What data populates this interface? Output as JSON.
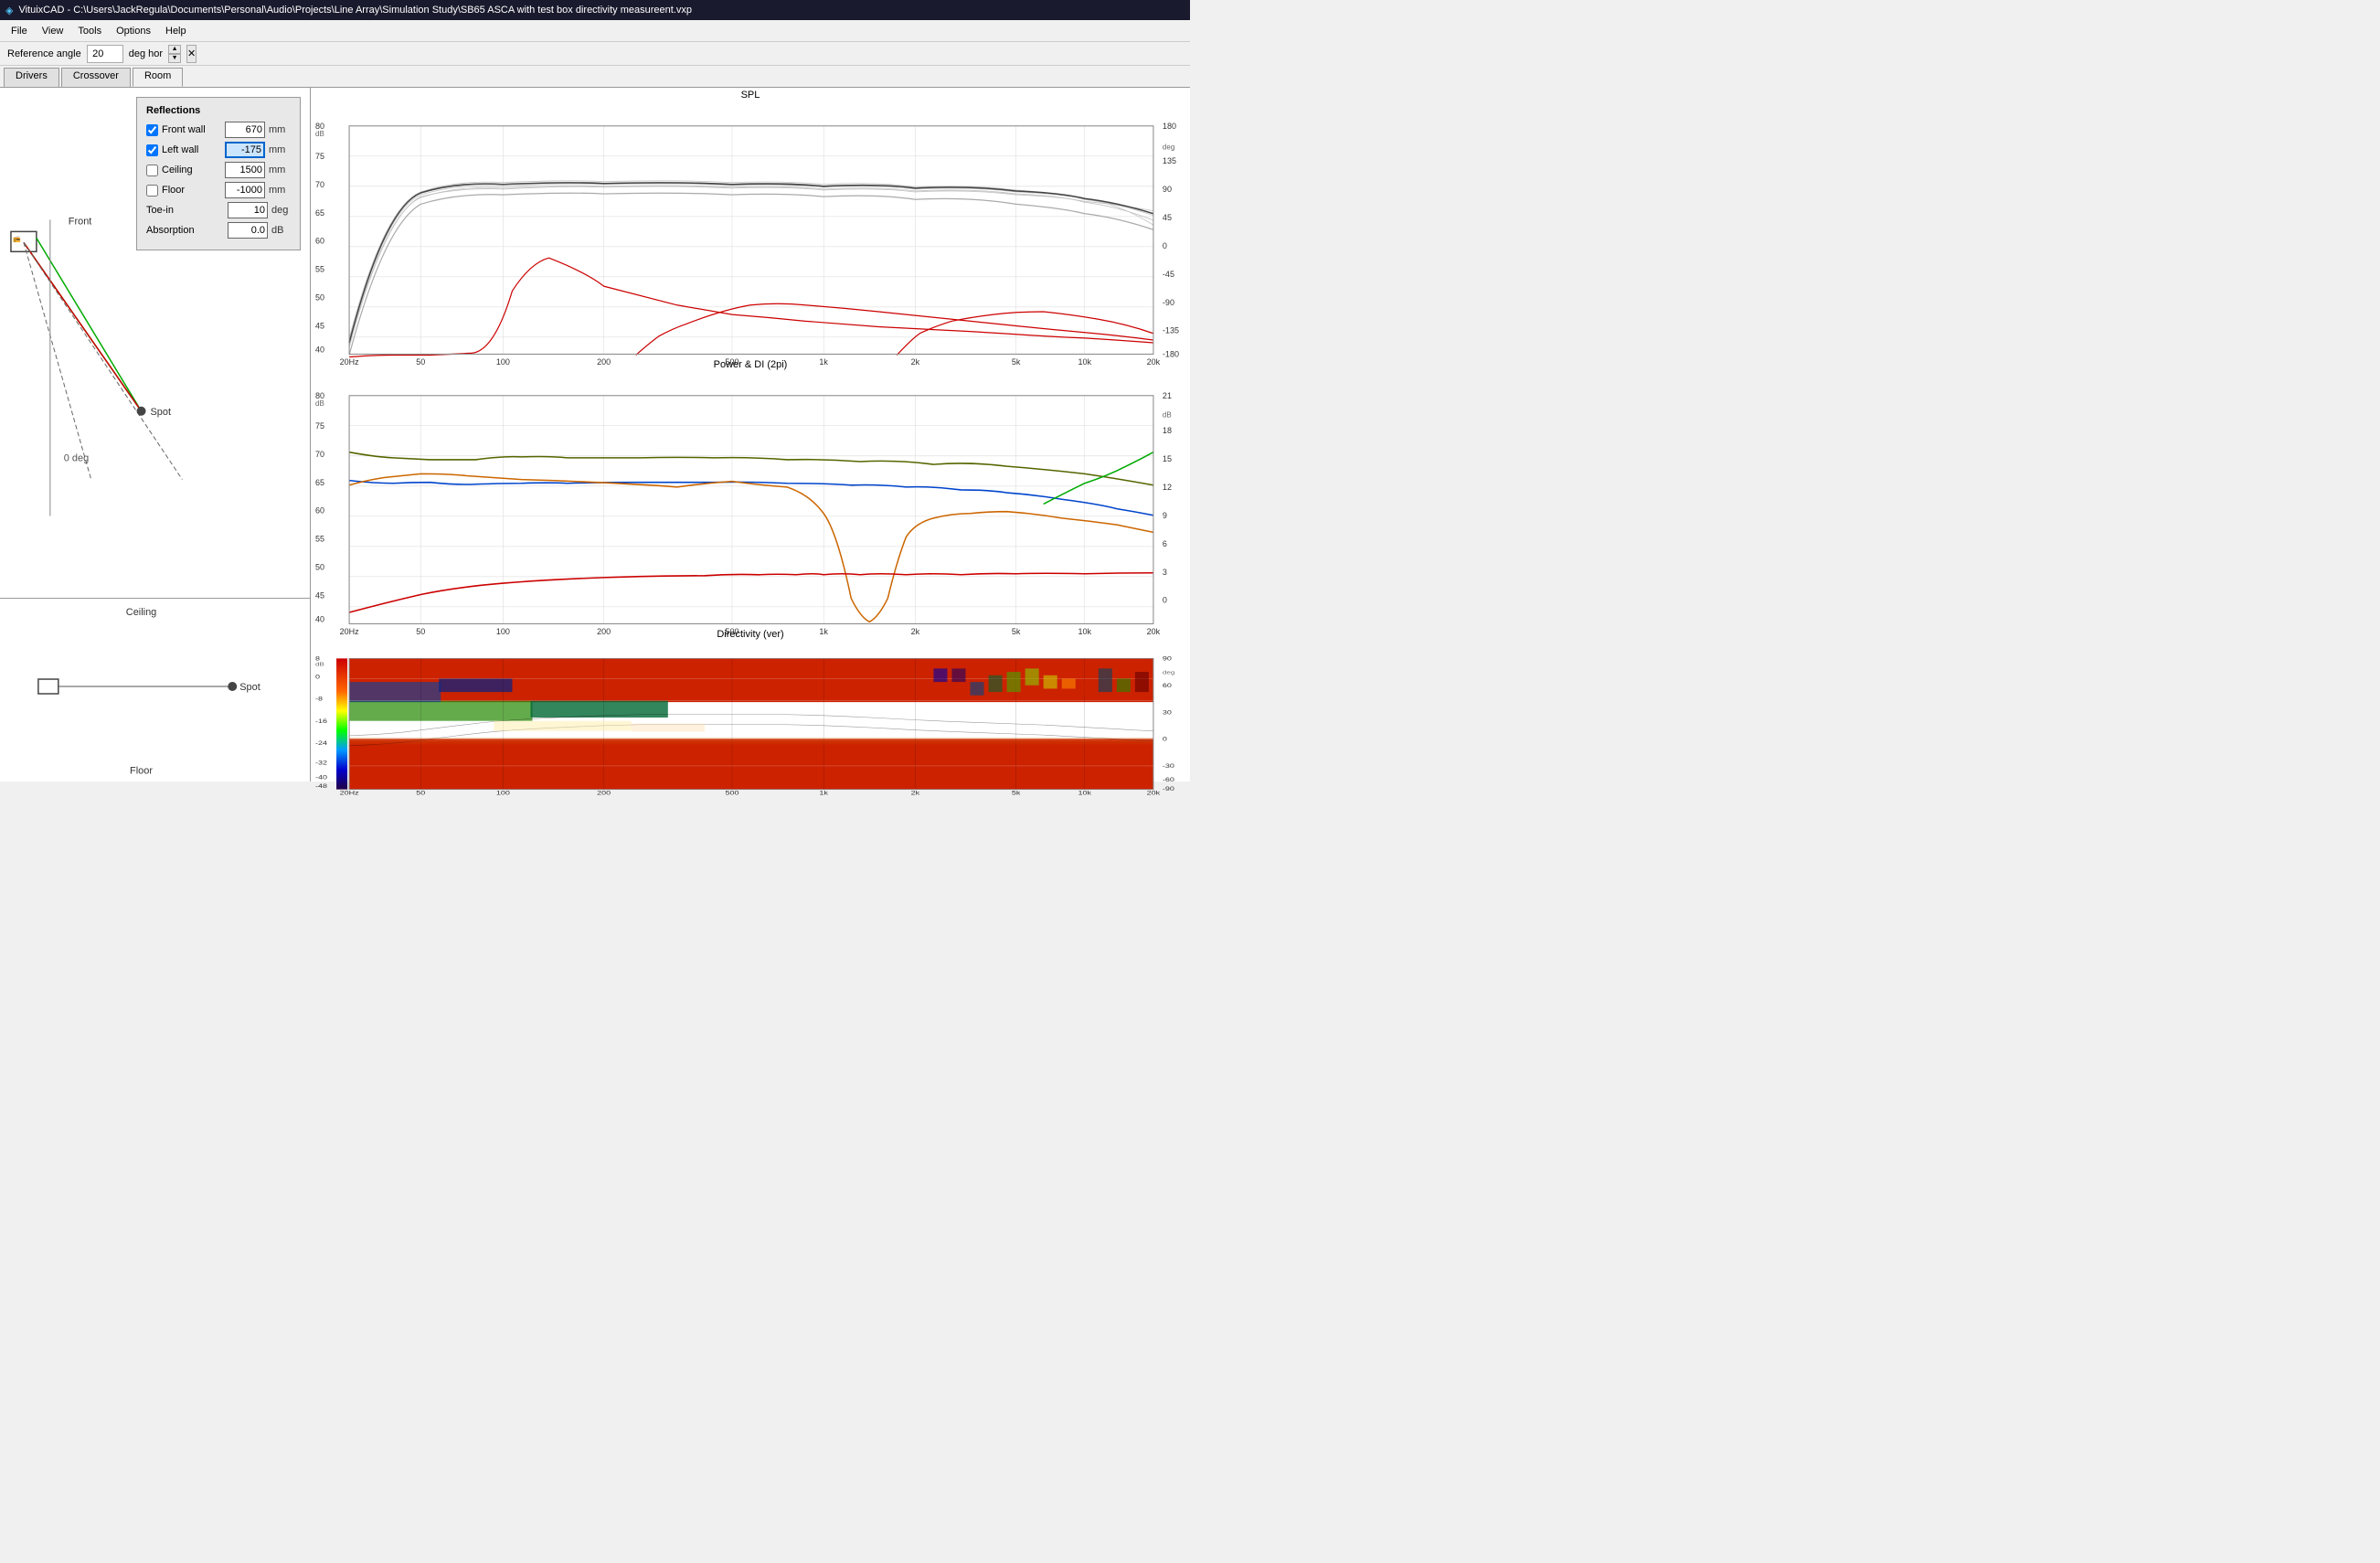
{
  "titleBar": {
    "appName": "VituixCAD",
    "filePath": "C:\\Users\\JackRegula\\Documents\\Personal\\Audio\\Projects\\Line Array\\Simulation Study\\SB65 ASCA with test box directivity measureent.vxp"
  },
  "menuBar": {
    "items": [
      "File",
      "View",
      "Tools",
      "Options",
      "Help"
    ]
  },
  "toolbar": {
    "referenceAngleLabel": "Reference angle",
    "referenceAngleValue": "20",
    "degHorLabel": "deg hor"
  },
  "tabs": {
    "items": [
      "Drivers",
      "Crossover",
      "Room"
    ],
    "active": "Room"
  },
  "reflections": {
    "title": "Reflections",
    "frontWall": {
      "checked": true,
      "label": "Front wall",
      "value": "670",
      "unit": "mm"
    },
    "leftWall": {
      "checked": true,
      "label": "Left wall",
      "value": "-175",
      "unit": "mm"
    },
    "ceiling": {
      "checked": false,
      "label": "Ceiling",
      "value": "1500",
      "unit": "mm"
    },
    "floor": {
      "checked": false,
      "label": "Floor",
      "value": "-1000",
      "unit": "mm"
    },
    "toeIn": {
      "label": "Toe-in",
      "value": "10",
      "unit": "deg"
    },
    "absorption": {
      "label": "Absorption",
      "value": "0.0",
      "unit": "dB"
    }
  },
  "roomDiagramTop": {
    "frontLabel": "Front",
    "spotLabel": "Spot",
    "degLabel": "0 deg"
  },
  "roomDiagramBottom": {
    "ceilingLabel": "Ceiling",
    "floorLabel": "Floor",
    "spotLabel": "Spot"
  },
  "charts": {
    "spl": {
      "title": "SPL",
      "yAxisLeft": {
        "min": 40,
        "max": 80,
        "unit": "dB"
      },
      "yAxisRight": {
        "min": -180,
        "max": 180,
        "unit": "deg"
      },
      "xAxis": {
        "labels": [
          "20Hz",
          "50",
          "100",
          "200",
          "500",
          "1k",
          "2k",
          "5k",
          "10k",
          "20k"
        ]
      }
    },
    "power": {
      "title": "Power & DI (2pi)",
      "yAxisLeft": {
        "min": 40,
        "max": 80,
        "unit": "dB"
      },
      "yAxisRight": {
        "min": 0,
        "max": 21,
        "unit": "dB"
      },
      "xAxis": {
        "labels": [
          "20Hz",
          "50",
          "100",
          "200",
          "500",
          "1k",
          "2k",
          "5k",
          "10k",
          "20k"
        ]
      }
    },
    "directivity": {
      "title": "Directivity (ver)",
      "yAxisLeft": {
        "min": -48,
        "max": 8,
        "unit": "dB"
      },
      "yAxisRight": {
        "min": -90,
        "max": 90,
        "unit": "deg"
      },
      "xAxis": {
        "labels": [
          "20Hz",
          "50",
          "100",
          "200",
          "500",
          "1k",
          "2k",
          "5k",
          "10k",
          "20k"
        ]
      }
    }
  }
}
